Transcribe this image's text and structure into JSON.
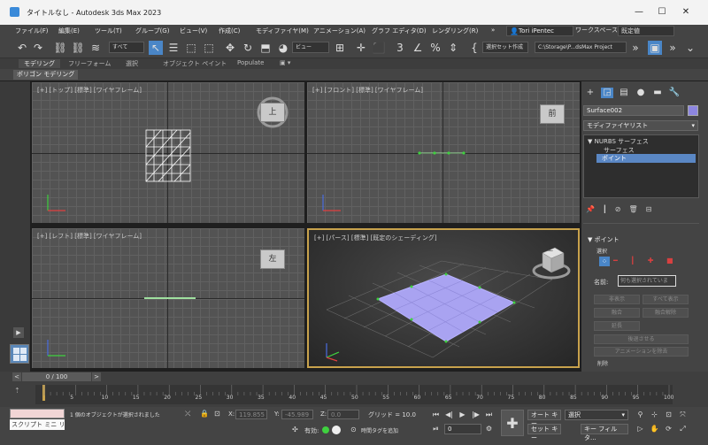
{
  "window": {
    "title": "タイトルなし - Autodesk 3ds Max 2023",
    "controls": {
      "minimize": "—",
      "maximize": "☐",
      "close": "✕"
    }
  },
  "menu": {
    "items": [
      "ファイル(F)",
      "編集(E)",
      "ツール(T)",
      "グループ(G)",
      "ビュー(V)",
      "作成(C)",
      "モディファイヤ(M)",
      "アニメーション(A)",
      "グラフ エディタ(D)",
      "レンダリング(R)"
    ],
    "overflow": "»",
    "user": "Tori iPentec",
    "workspace_label": "ワークスペース:",
    "workspace_value": "既定値"
  },
  "toolbar": {
    "filter_value": "すべて",
    "view_value": "ビュー",
    "selection_set": "選択セット作成",
    "project_path": "C:\\Storage\\P...dsMax Project"
  },
  "ribbon": {
    "tabs": [
      "モデリング",
      "フリーフォーム",
      "選択",
      "オブジェクト ペイント",
      "Populate"
    ],
    "panel_label": "ポリゴン モデリング"
  },
  "viewports": [
    {
      "label": "[+] [トップ] [標準] [ワイヤフレーム]",
      "cube_face": "上"
    },
    {
      "label": "[+] [フロント] [標準] [ワイヤフレーム]",
      "cube_face": "前"
    },
    {
      "label": "[+] [レフト] [標準] [ワイヤフレーム]",
      "cube_face": "左"
    },
    {
      "label": "[+] [パース] [標準] [既定のシェーディング]",
      "cube_face": "上"
    }
  ],
  "command_panel": {
    "object_name": "Surface002",
    "object_color": "#8d86e0",
    "modifier_list": "モディファイヤリスト",
    "stack": [
      {
        "label": "NURBS サーフェス",
        "selected": false
      },
      {
        "label": "サーフェス",
        "selected": false
      },
      {
        "label": "ポイント",
        "selected": true
      }
    ],
    "rollout_title": "ポイント",
    "selection_label": "選択",
    "name_label": "名前:",
    "name_placeholder": "何も選択されていま",
    "buttons": [
      "非表示",
      "すべて表示",
      "融合",
      "融合解除",
      "延長",
      "後退させる",
      "アニメーションを除去"
    ],
    "delete_label": "削除"
  },
  "timeline": {
    "frame_display": "0 / 100",
    "prev": "<",
    "next": ">",
    "ticks": [
      "0",
      "5",
      "10",
      "15",
      "20",
      "25",
      "30",
      "35",
      "40",
      "45",
      "50",
      "55",
      "60",
      "65",
      "70",
      "75",
      "80",
      "85",
      "90",
      "95",
      "100"
    ]
  },
  "status": {
    "script_label": "スクリプト ミニ リス",
    "message": "1 個のオブジェクトが選択されました",
    "x_label": "X:",
    "x_value": "119.855",
    "y_label": "Y:",
    "y_value": "-45.989",
    "z_label": "Z:",
    "z_value": "0.0",
    "grid": "グリッド = 10.0",
    "enabled_label": "有効:",
    "add_time_tag": "時間タグを追加",
    "frame_value": "0",
    "auto_key": "オート キー",
    "set_key": "セット キー",
    "selection_dd": "選択",
    "key_filters": "キー フィルタ..."
  }
}
